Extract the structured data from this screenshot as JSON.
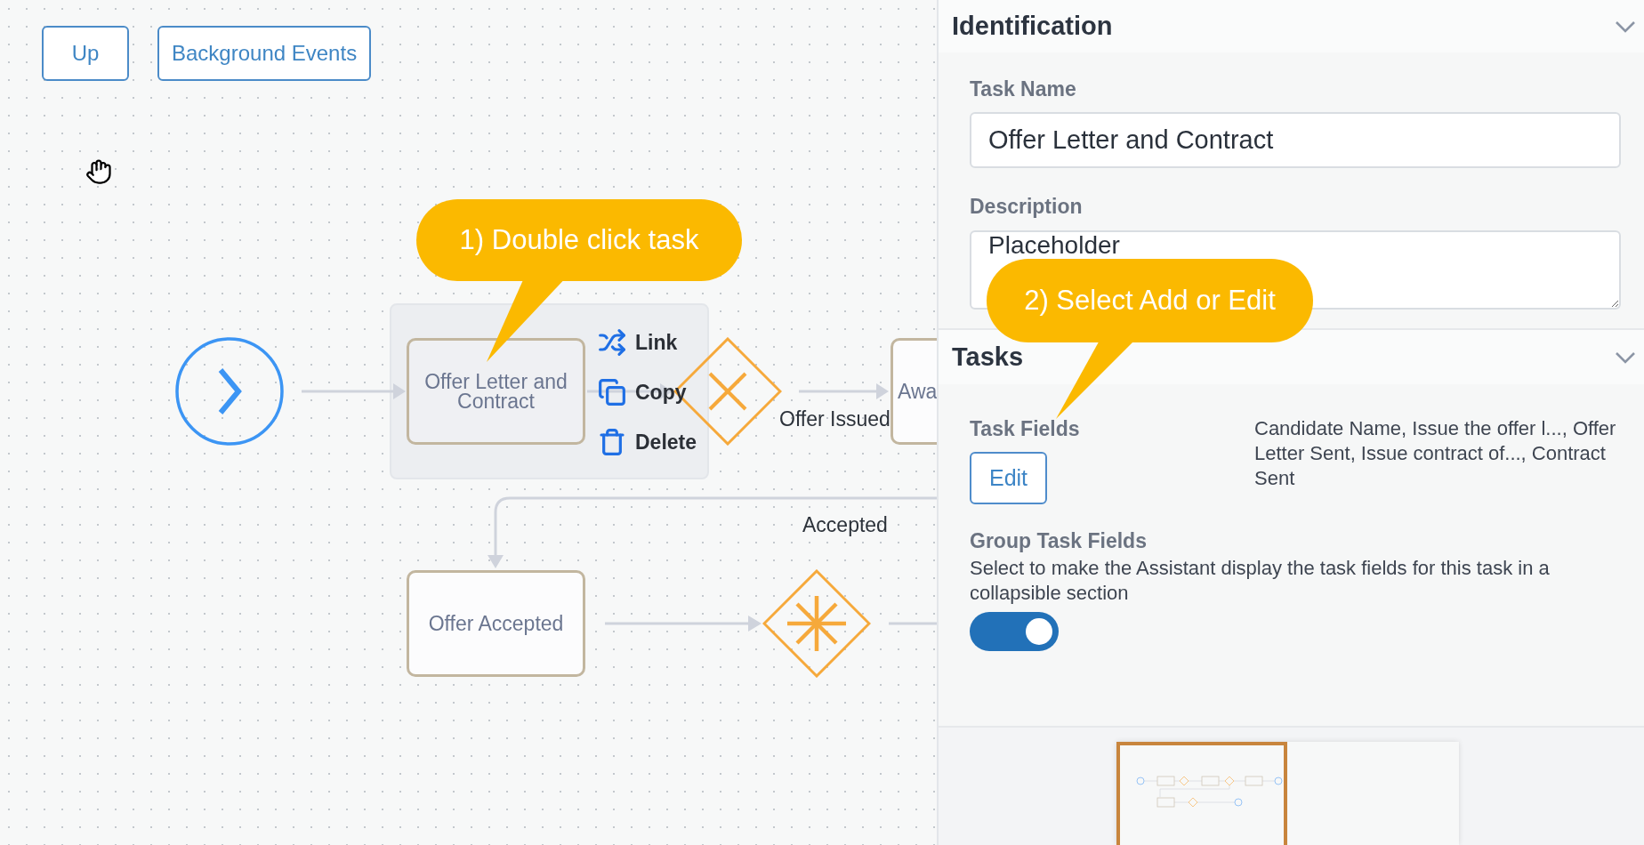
{
  "toolbar": {
    "buttons": [
      "Up",
      "Background Events"
    ]
  },
  "diagram": {
    "nodes": [
      {
        "kind": "start",
        "selected": false
      },
      {
        "kind": "task",
        "label": "Offer Letter and Contract",
        "selected": true
      },
      {
        "kind": "exclusive",
        "selected": false
      },
      {
        "kind": "task",
        "label": "Awa",
        "selected": false
      },
      {
        "kind": "task",
        "label": "Offer Accepted",
        "selected": false
      },
      {
        "kind": "complex",
        "selected": false
      }
    ],
    "node_menu": [
      "Link",
      "Copy",
      "Delete"
    ],
    "edge_labels": [
      "Offer Issued",
      "Accepted"
    ]
  },
  "callouts": [
    "1) Double click task",
    "2) Select Add or Edit"
  ],
  "identification": {
    "title": "Identification",
    "expanded": true,
    "task_name": {
      "label": "Task Name",
      "value": "Offer Letter and Contract"
    },
    "description": {
      "label": "Description",
      "value": "Placeholder"
    }
  },
  "tasks": {
    "title": "Tasks",
    "expanded": true,
    "task_fields": {
      "label": "Task Fields",
      "button": "Edit",
      "summary": "Candidate Name, Issue the offer l..., Offer Letter Sent, Issue contract of..., Contract Sent"
    },
    "group_task_fields": {
      "label": "Group Task Fields",
      "description": "Select to make the Assistant display the task fields for this task in a collapsible section",
      "on": true
    }
  }
}
